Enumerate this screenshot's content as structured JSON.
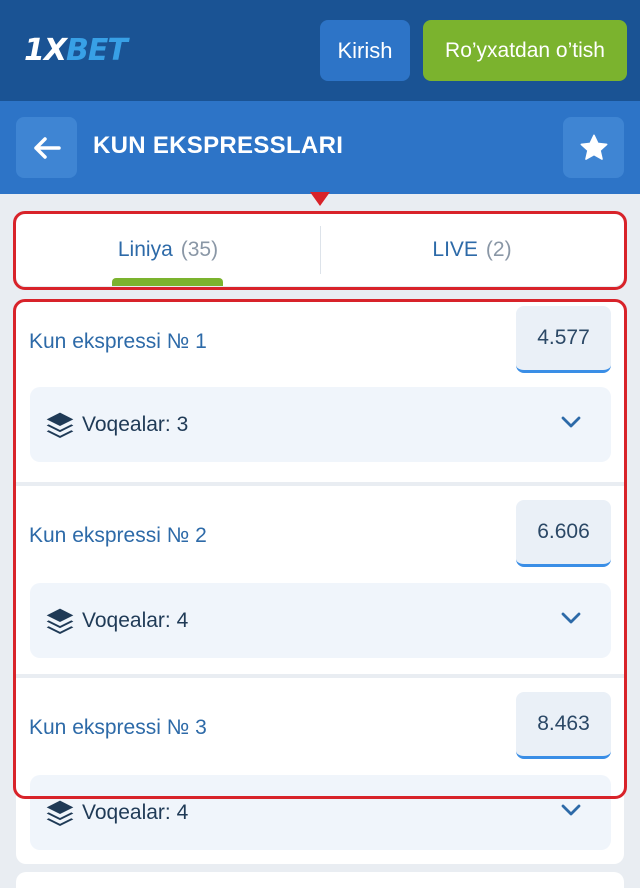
{
  "topbar": {
    "logo_main": "1X",
    "logo_accent": "BET",
    "login_label": "Kirish",
    "register_label": "Ro’yxatdan o’tish"
  },
  "header": {
    "title": "KUN EKSPRESSLARI"
  },
  "tabs": [
    {
      "label": "Liniya",
      "count": "(35)"
    },
    {
      "label": "LIVE",
      "count": "(2)"
    }
  ],
  "expresses": [
    {
      "title": "Kun ekspressi № 1",
      "coef": "4.577",
      "events": "Voqealar: 3"
    },
    {
      "title": "Kun ekspressi № 2",
      "coef": "6.606",
      "events": "Voqealar: 4"
    },
    {
      "title": "Kun ekspressi № 3",
      "coef": "8.463",
      "events": "Voqealar: 4"
    }
  ],
  "colors": {
    "topbar": "#1a5394",
    "header": "#2d74c7",
    "accent_green": "#7bb32e",
    "highlight_red": "#d8232a",
    "link_blue": "#2d6aa8"
  }
}
